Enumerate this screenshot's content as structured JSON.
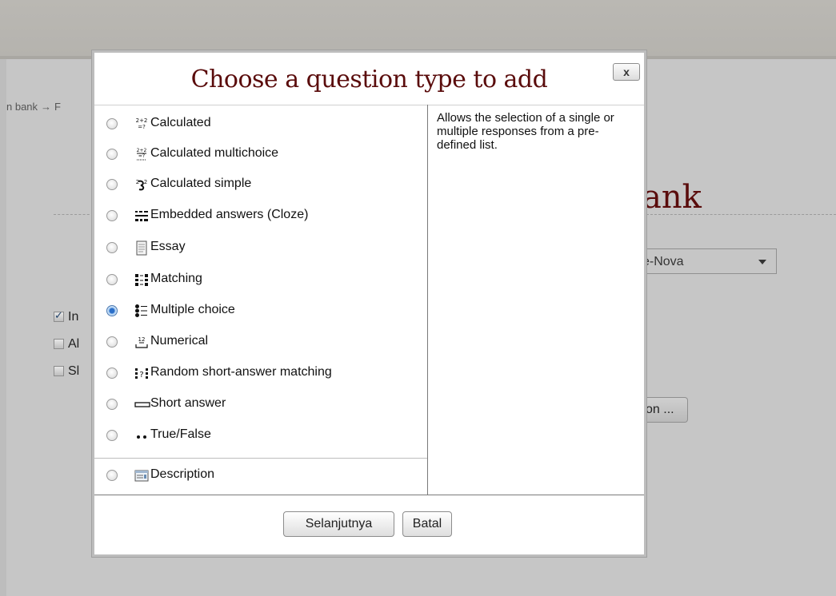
{
  "background": {
    "breadcrumb": [
      "n bank",
      "F"
    ],
    "breadcrumb_sep": "→",
    "page_heading": "ank",
    "category_select_value": "e-Nova",
    "checkbox_labels": [
      "In",
      "Al",
      "Sl"
    ],
    "create_button_label": "on ..."
  },
  "dialog": {
    "title": "Choose a question type to add",
    "close_label": "x",
    "question_types": [
      {
        "label": "Calculated",
        "icon": "calculated-icon",
        "selected": false
      },
      {
        "label": "Calculated multichoice",
        "icon": "calculated-multichoice-icon",
        "selected": false
      },
      {
        "label": "Calculated simple",
        "icon": "calculated-simple-icon",
        "selected": false
      },
      {
        "label": "Embedded answers (Cloze)",
        "icon": "cloze-icon",
        "selected": false
      },
      {
        "label": "Essay",
        "icon": "essay-icon",
        "selected": false
      },
      {
        "label": "Matching",
        "icon": "matching-icon",
        "selected": false
      },
      {
        "label": "Multiple choice",
        "icon": "multiple-choice-icon",
        "selected": true
      },
      {
        "label": "Numerical",
        "icon": "numerical-icon",
        "selected": false
      },
      {
        "label": "Random short-answer matching",
        "icon": "random-matching-icon",
        "selected": false
      },
      {
        "label": "Short answer",
        "icon": "short-answer-icon",
        "selected": false
      },
      {
        "label": "True/False",
        "icon": "true-false-icon",
        "selected": false
      }
    ],
    "other_types": [
      {
        "label": "Description",
        "icon": "description-icon",
        "selected": false
      }
    ],
    "icon_text": {
      "calculated": "2+2\n=?",
      "numerical": "12"
    },
    "selected_description": "Allows the selection of a single or multiple responses from a pre-defined list.",
    "buttons": {
      "next": "Selanjutnya",
      "cancel": "Batal"
    }
  },
  "colors": {
    "title": "#5a0c0c",
    "overlay_bg": "#c6c6c6",
    "radio_selected": "#2b6fc9"
  }
}
